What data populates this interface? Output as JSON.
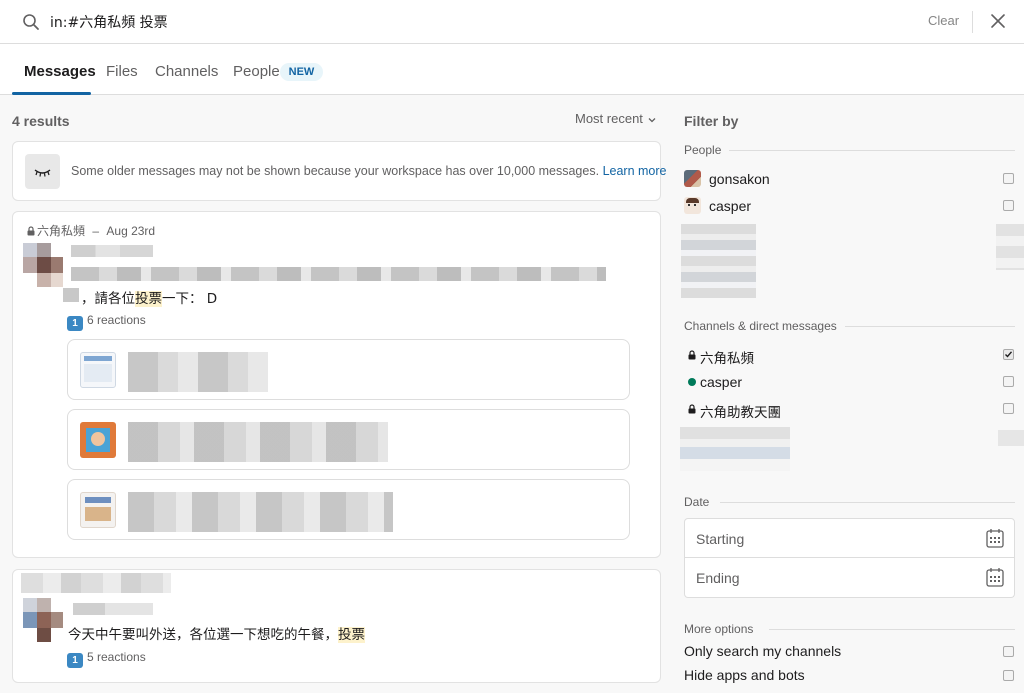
{
  "search": {
    "query": "in:#六角私頻 投票",
    "clear_label": "Clear"
  },
  "tabs": [
    {
      "label": "Messages",
      "active": true
    },
    {
      "label": "Files",
      "active": false
    },
    {
      "label": "Channels",
      "active": false
    },
    {
      "label": "People",
      "active": false,
      "badge": "NEW"
    }
  ],
  "results": {
    "count_label": "4 results",
    "sort_label": "Most recent",
    "notice": {
      "text": "Some older messages may not be shown because your workspace has over 10,000 messages.",
      "link": "Learn more"
    },
    "messages": [
      {
        "channel": "六角私頻",
        "separator": "–",
        "date": "Aug 23rd",
        "text_before": "，請各位",
        "highlight": "投票",
        "text_after": "一下： D",
        "reactions_icon": "1",
        "reactions": "6 reactions",
        "attachments": 3
      },
      {
        "text_before": "今天中午要叫外送，各位選一下想吃的午餐，",
        "highlight": "投票",
        "text_after": "",
        "reactions_icon": "1",
        "reactions": "5 reactions"
      }
    ]
  },
  "filters": {
    "title": "Filter by",
    "people_label": "People",
    "people": [
      {
        "name": "gonsakon",
        "checked": false
      },
      {
        "name": "casper",
        "checked": false
      }
    ],
    "channels_label": "Channels & direct messages",
    "channels": [
      {
        "name": "六角私頻",
        "type": "private",
        "checked": true
      },
      {
        "name": "casper",
        "type": "dm-online",
        "checked": false
      },
      {
        "name": "六角助教天團",
        "type": "private",
        "checked": false
      }
    ],
    "date_label": "Date",
    "date_start": "Starting",
    "date_end": "Ending",
    "more_label": "More options",
    "options": [
      {
        "label": "Only search my channels",
        "checked": false
      },
      {
        "label": "Hide apps and bots",
        "checked": false
      }
    ]
  },
  "colors": {
    "accent": "#1264a3",
    "highlight": "#fdf2cc",
    "online": "#007a5a"
  }
}
